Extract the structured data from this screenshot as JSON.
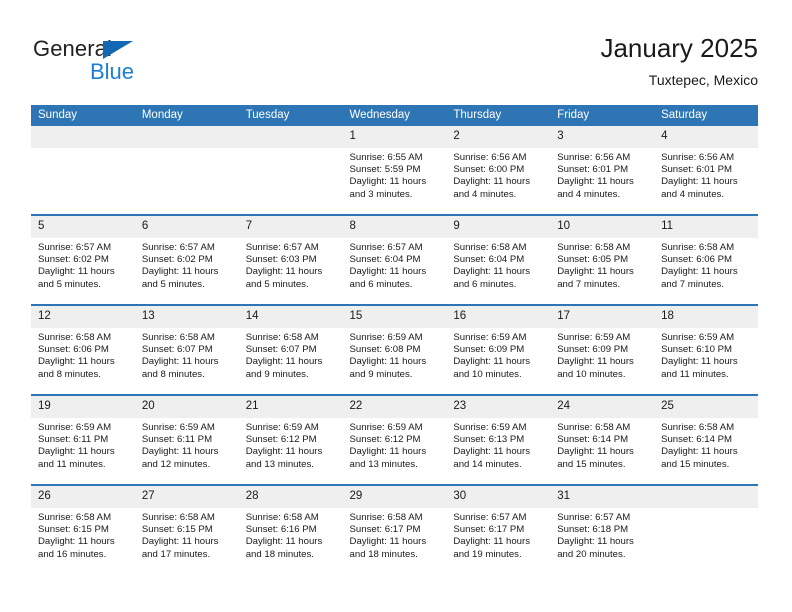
{
  "brand": {
    "name_top": "General",
    "name_bottom": "Blue",
    "triangle_color": "#1268b3",
    "blue_text_color": "#1b7fd4"
  },
  "header": {
    "title": "January 2025",
    "subtitle": "Tuxtepec, Mexico"
  },
  "theme": {
    "header_blue": "#2e75b6",
    "daynum_band": "#efefef",
    "text": "#1a1a1a"
  },
  "calendar": {
    "weekday_headers": [
      "Sunday",
      "Monday",
      "Tuesday",
      "Wednesday",
      "Thursday",
      "Friday",
      "Saturday"
    ],
    "weeks": [
      [
        {
          "day": "",
          "empty": true
        },
        {
          "day": "",
          "empty": true
        },
        {
          "day": "",
          "empty": true
        },
        {
          "day": "1",
          "sunrise": "Sunrise: 6:55 AM",
          "sunset": "Sunset: 5:59 PM",
          "daylight_1": "Daylight: 11 hours",
          "daylight_2": "and 3 minutes."
        },
        {
          "day": "2",
          "sunrise": "Sunrise: 6:56 AM",
          "sunset": "Sunset: 6:00 PM",
          "daylight_1": "Daylight: 11 hours",
          "daylight_2": "and 4 minutes."
        },
        {
          "day": "3",
          "sunrise": "Sunrise: 6:56 AM",
          "sunset": "Sunset: 6:01 PM",
          "daylight_1": "Daylight: 11 hours",
          "daylight_2": "and 4 minutes."
        },
        {
          "day": "4",
          "sunrise": "Sunrise: 6:56 AM",
          "sunset": "Sunset: 6:01 PM",
          "daylight_1": "Daylight: 11 hours",
          "daylight_2": "and 4 minutes."
        }
      ],
      [
        {
          "day": "5",
          "sunrise": "Sunrise: 6:57 AM",
          "sunset": "Sunset: 6:02 PM",
          "daylight_1": "Daylight: 11 hours",
          "daylight_2": "and 5 minutes."
        },
        {
          "day": "6",
          "sunrise": "Sunrise: 6:57 AM",
          "sunset": "Sunset: 6:02 PM",
          "daylight_1": "Daylight: 11 hours",
          "daylight_2": "and 5 minutes."
        },
        {
          "day": "7",
          "sunrise": "Sunrise: 6:57 AM",
          "sunset": "Sunset: 6:03 PM",
          "daylight_1": "Daylight: 11 hours",
          "daylight_2": "and 5 minutes."
        },
        {
          "day": "8",
          "sunrise": "Sunrise: 6:57 AM",
          "sunset": "Sunset: 6:04 PM",
          "daylight_1": "Daylight: 11 hours",
          "daylight_2": "and 6 minutes."
        },
        {
          "day": "9",
          "sunrise": "Sunrise: 6:58 AM",
          "sunset": "Sunset: 6:04 PM",
          "daylight_1": "Daylight: 11 hours",
          "daylight_2": "and 6 minutes."
        },
        {
          "day": "10",
          "sunrise": "Sunrise: 6:58 AM",
          "sunset": "Sunset: 6:05 PM",
          "daylight_1": "Daylight: 11 hours",
          "daylight_2": "and 7 minutes."
        },
        {
          "day": "11",
          "sunrise": "Sunrise: 6:58 AM",
          "sunset": "Sunset: 6:06 PM",
          "daylight_1": "Daylight: 11 hours",
          "daylight_2": "and 7 minutes."
        }
      ],
      [
        {
          "day": "12",
          "sunrise": "Sunrise: 6:58 AM",
          "sunset": "Sunset: 6:06 PM",
          "daylight_1": "Daylight: 11 hours",
          "daylight_2": "and 8 minutes."
        },
        {
          "day": "13",
          "sunrise": "Sunrise: 6:58 AM",
          "sunset": "Sunset: 6:07 PM",
          "daylight_1": "Daylight: 11 hours",
          "daylight_2": "and 8 minutes."
        },
        {
          "day": "14",
          "sunrise": "Sunrise: 6:58 AM",
          "sunset": "Sunset: 6:07 PM",
          "daylight_1": "Daylight: 11 hours",
          "daylight_2": "and 9 minutes."
        },
        {
          "day": "15",
          "sunrise": "Sunrise: 6:59 AM",
          "sunset": "Sunset: 6:08 PM",
          "daylight_1": "Daylight: 11 hours",
          "daylight_2": "and 9 minutes."
        },
        {
          "day": "16",
          "sunrise": "Sunrise: 6:59 AM",
          "sunset": "Sunset: 6:09 PM",
          "daylight_1": "Daylight: 11 hours",
          "daylight_2": "and 10 minutes."
        },
        {
          "day": "17",
          "sunrise": "Sunrise: 6:59 AM",
          "sunset": "Sunset: 6:09 PM",
          "daylight_1": "Daylight: 11 hours",
          "daylight_2": "and 10 minutes."
        },
        {
          "day": "18",
          "sunrise": "Sunrise: 6:59 AM",
          "sunset": "Sunset: 6:10 PM",
          "daylight_1": "Daylight: 11 hours",
          "daylight_2": "and 11 minutes."
        }
      ],
      [
        {
          "day": "19",
          "sunrise": "Sunrise: 6:59 AM",
          "sunset": "Sunset: 6:11 PM",
          "daylight_1": "Daylight: 11 hours",
          "daylight_2": "and 11 minutes."
        },
        {
          "day": "20",
          "sunrise": "Sunrise: 6:59 AM",
          "sunset": "Sunset: 6:11 PM",
          "daylight_1": "Daylight: 11 hours",
          "daylight_2": "and 12 minutes."
        },
        {
          "day": "21",
          "sunrise": "Sunrise: 6:59 AM",
          "sunset": "Sunset: 6:12 PM",
          "daylight_1": "Daylight: 11 hours",
          "daylight_2": "and 13 minutes."
        },
        {
          "day": "22",
          "sunrise": "Sunrise: 6:59 AM",
          "sunset": "Sunset: 6:12 PM",
          "daylight_1": "Daylight: 11 hours",
          "daylight_2": "and 13 minutes."
        },
        {
          "day": "23",
          "sunrise": "Sunrise: 6:59 AM",
          "sunset": "Sunset: 6:13 PM",
          "daylight_1": "Daylight: 11 hours",
          "daylight_2": "and 14 minutes."
        },
        {
          "day": "24",
          "sunrise": "Sunrise: 6:58 AM",
          "sunset": "Sunset: 6:14 PM",
          "daylight_1": "Daylight: 11 hours",
          "daylight_2": "and 15 minutes."
        },
        {
          "day": "25",
          "sunrise": "Sunrise: 6:58 AM",
          "sunset": "Sunset: 6:14 PM",
          "daylight_1": "Daylight: 11 hours",
          "daylight_2": "and 15 minutes."
        }
      ],
      [
        {
          "day": "26",
          "sunrise": "Sunrise: 6:58 AM",
          "sunset": "Sunset: 6:15 PM",
          "daylight_1": "Daylight: 11 hours",
          "daylight_2": "and 16 minutes."
        },
        {
          "day": "27",
          "sunrise": "Sunrise: 6:58 AM",
          "sunset": "Sunset: 6:15 PM",
          "daylight_1": "Daylight: 11 hours",
          "daylight_2": "and 17 minutes."
        },
        {
          "day": "28",
          "sunrise": "Sunrise: 6:58 AM",
          "sunset": "Sunset: 6:16 PM",
          "daylight_1": "Daylight: 11 hours",
          "daylight_2": "and 18 minutes."
        },
        {
          "day": "29",
          "sunrise": "Sunrise: 6:58 AM",
          "sunset": "Sunset: 6:17 PM",
          "daylight_1": "Daylight: 11 hours",
          "daylight_2": "and 18 minutes."
        },
        {
          "day": "30",
          "sunrise": "Sunrise: 6:57 AM",
          "sunset": "Sunset: 6:17 PM",
          "daylight_1": "Daylight: 11 hours",
          "daylight_2": "and 19 minutes."
        },
        {
          "day": "31",
          "sunrise": "Sunrise: 6:57 AM",
          "sunset": "Sunset: 6:18 PM",
          "daylight_1": "Daylight: 11 hours",
          "daylight_2": "and 20 minutes."
        },
        {
          "day": "",
          "empty": true
        }
      ]
    ]
  }
}
